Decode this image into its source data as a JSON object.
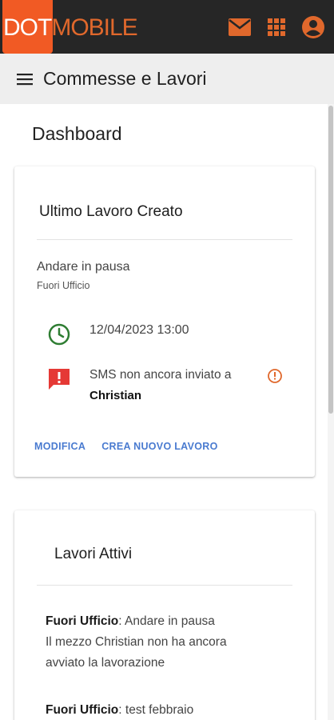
{
  "header": {
    "logo_dot": "DOT",
    "logo_mobile": "MOBILE",
    "icons": [
      "mail-icon",
      "apps-grid-icon",
      "account-circle-icon"
    ],
    "accent_color": "#e0682c",
    "bar_color": "#262626"
  },
  "subheader": {
    "title": "Commesse e Lavori",
    "menu_icon": "hamburger-menu-icon"
  },
  "dashboard": {
    "title": "Dashboard"
  },
  "last_job": {
    "title": "Ultimo Lavoro Creato",
    "job_name": "Andare in pausa",
    "job_category": "Fuori Ufficio",
    "datetime": "12/04/2023 13:00",
    "sms_status": "SMS non ancora inviato a",
    "sms_recipient": "Christian",
    "actions": {
      "edit": "MODIFICA",
      "create": "CREA NUOVO LAVORO"
    },
    "clock_color": "#2e7d32",
    "alert_color": "#e53935",
    "action_color": "#4a7bd0"
  },
  "active_jobs": {
    "title": "Lavori Attivi",
    "items": [
      {
        "category": "Fuori Ufficio",
        "name": ": Andare in pausa",
        "line2": "Il mezzo Christian non ha ancora",
        "line3": "avviato la lavorazione"
      },
      {
        "category": "Fuori Ufficio",
        "name": ": test febbraio"
      }
    ]
  }
}
